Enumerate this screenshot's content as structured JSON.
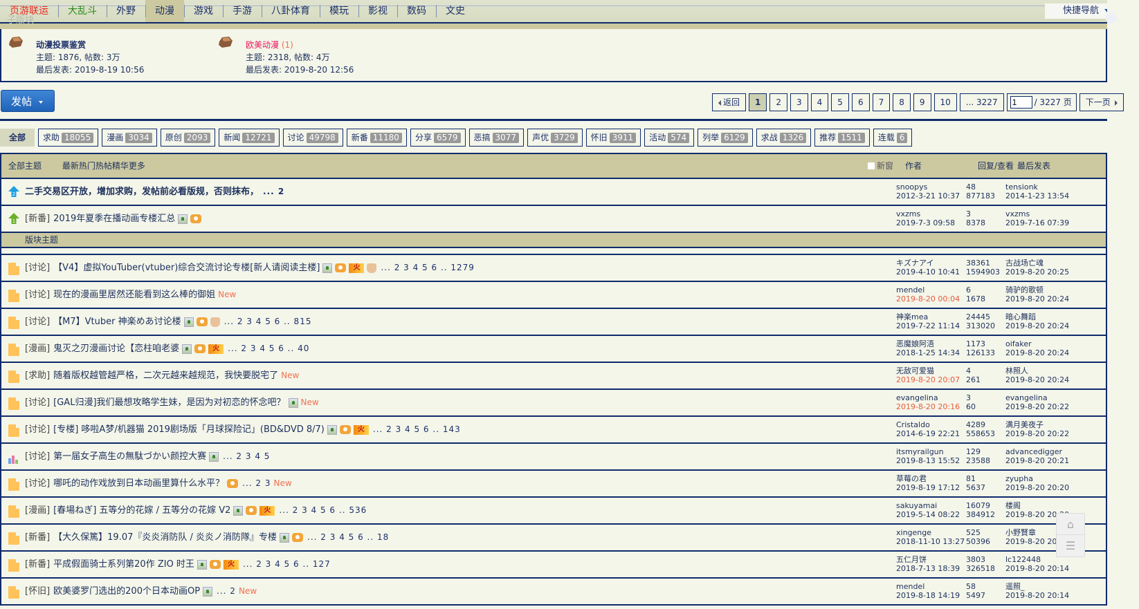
{
  "topnav": {
    "faint_label": "子版块",
    "items": [
      {
        "label": "页游联运",
        "style": "red"
      },
      {
        "label": "大乱斗",
        "style": "green"
      },
      {
        "label": "外野",
        "style": ""
      },
      {
        "label": "动漫",
        "style": "active"
      },
      {
        "label": "游戏",
        "style": ""
      },
      {
        "label": "手游",
        "style": ""
      },
      {
        "label": "八卦体育",
        "style": ""
      },
      {
        "label": "模玩",
        "style": ""
      },
      {
        "label": "影视",
        "style": ""
      },
      {
        "label": "数码",
        "style": ""
      },
      {
        "label": "文史",
        "style": ""
      }
    ],
    "quick_nav": "快捷导航"
  },
  "subforums": [
    {
      "name": "动漫投票鉴赏",
      "count": "",
      "stats": "主题: 1876, 帖数: 3万",
      "last": "最后发表: 2019-8-19 10:56"
    },
    {
      "name": "欧美动漫",
      "count": "(1)",
      "stats": "主题: 2318, 帖数: 4万",
      "last": "最后发表: 2019-8-20 12:56"
    }
  ],
  "post_button": "发帖",
  "pager": {
    "back": "返回",
    "pages": [
      "1",
      "2",
      "3",
      "4",
      "5",
      "6",
      "7",
      "8",
      "9",
      "10"
    ],
    "current": "1",
    "last": "... 3227",
    "input_value": "1",
    "total": "/ 3227 页",
    "next": "下一页"
  },
  "types": [
    {
      "label": "全部",
      "count": ""
    },
    {
      "label": "求助",
      "count": "18055"
    },
    {
      "label": "漫画",
      "count": "3034"
    },
    {
      "label": "原创",
      "count": "2093"
    },
    {
      "label": "新闻",
      "count": "12721"
    },
    {
      "label": "讨论",
      "count": "49798"
    },
    {
      "label": "新番",
      "count": "11180"
    },
    {
      "label": "分享",
      "count": "6579"
    },
    {
      "label": "恶搞",
      "count": "3077"
    },
    {
      "label": "声优",
      "count": "3729"
    },
    {
      "label": "怀旧",
      "count": "3911"
    },
    {
      "label": "活动",
      "count": "574"
    },
    {
      "label": "列举",
      "count": "6129"
    },
    {
      "label": "求战",
      "count": "1326"
    },
    {
      "label": "推荐",
      "count": "1511"
    },
    {
      "label": "连载",
      "count": "6"
    }
  ],
  "table_header": {
    "all": "全部主题",
    "filters": [
      "最新",
      "热门",
      "热帖",
      "精华",
      "更多"
    ],
    "new_window": "新窗",
    "author": "作者",
    "replies_views": "回复/查看",
    "last_post": "最后发表"
  },
  "sticky": [
    {
      "icon": "pin-2-icon",
      "tag": "",
      "title": "二手交易区开放，增加求购，发帖前必看版规，否则抹布，",
      "bold": true,
      "badges": [],
      "pages": "... 2",
      "new": "",
      "author": "snoopys",
      "date": "2012-3-21 10:37",
      "date_red": false,
      "replies": "48",
      "views": "877183",
      "last_user": "tensionk",
      "last_date": "2014-1-23 13:54"
    },
    {
      "icon": "pin-1-icon",
      "tag": "[新番]",
      "title": "2019年夏季在播动画专楼汇总",
      "bold": false,
      "badges": [
        "img",
        "cam"
      ],
      "pages": "",
      "new": "",
      "author": "vxzms",
      "date": "2019-7-3 09:58",
      "date_red": false,
      "replies": "3",
      "views": "8378",
      "last_user": "vxzms",
      "last_date": "2019-7-16 07:39"
    }
  ],
  "section_label": "版块主题",
  "threads": [
    {
      "icon": "folder",
      "tag": "[讨论]",
      "title": "【V4】虚拟YouTuber(vtuber)综合交流讨论专楼[新人请阅读主楼]",
      "badges": [
        "img",
        "cam",
        "hot",
        "like"
      ],
      "pages": "... 2 3 4 5 6 .. 1279",
      "new": "",
      "author": "キズナアイ",
      "date": "2019-4-10 10:41",
      "date_red": false,
      "replies": "38361",
      "views": "1594903",
      "last_user": "古战场亡魂",
      "last_date": "2019-8-20 20:25"
    },
    {
      "icon": "folder",
      "tag": "[讨论]",
      "title": "现在的漫画里居然还能看到这么棒的御姐",
      "badges": [],
      "pages": "",
      "new": "New",
      "author": "mendel",
      "date": "2019-8-20 00:04",
      "date_red": true,
      "replies": "6",
      "views": "1678",
      "last_user": "骑驴的歌顿",
      "last_date": "2019-8-20 20:24"
    },
    {
      "icon": "folder",
      "tag": "[讨论]",
      "title": "【M7】Vtuber 神楽めあ讨论楼",
      "badges": [
        "img",
        "cam",
        "like"
      ],
      "pages": "... 2 3 4 5 6 .. 815",
      "new": "",
      "author": "神楽mea",
      "date": "2019-7-22 11:14",
      "date_red": false,
      "replies": "24445",
      "views": "313020",
      "last_user": "暗心舞蹈",
      "last_date": "2019-8-20 20:24"
    },
    {
      "icon": "folder",
      "tag": "[漫画]",
      "title": "鬼灭之刃漫画讨论【恋柱咱老婆",
      "badges": [
        "img",
        "cam",
        "hot"
      ],
      "pages": "... 2 3 4 5 6 .. 40",
      "new": "",
      "author": "恶魔娘阿浯",
      "date": "2018-1-25 14:34",
      "date_red": false,
      "replies": "1173",
      "views": "126133",
      "last_user": "oifaker",
      "last_date": "2019-8-20 20:24"
    },
    {
      "icon": "folder",
      "tag": "[求助]",
      "title": "随着版权越管越严格，二次元越来越规范，我快要脱宅了",
      "badges": [],
      "pages": "",
      "new": "New",
      "author": "无敌可爱猫",
      "date": "2019-8-20 20:07",
      "date_red": true,
      "replies": "4",
      "views": "261",
      "last_user": "林照人",
      "last_date": "2019-8-20 20:24"
    },
    {
      "icon": "folder",
      "tag": "[讨论]",
      "title": "[GAL归漫]我们最想攻略学生妹，是因为对初恋的怀念吧？",
      "badges": [
        "img"
      ],
      "pages": "",
      "new": "New",
      "author": "evangelina",
      "date": "2019-8-20 20:16",
      "date_red": true,
      "replies": "3",
      "views": "60",
      "last_user": "evangelina",
      "last_date": "2019-8-20 20:22"
    },
    {
      "icon": "folder",
      "tag": "[讨论]",
      "title": "[专楼] 哆啦A梦/机器猫 2019剧场版「月球探险记」(BD&DVD 8/7)",
      "badges": [
        "img",
        "cam",
        "hot"
      ],
      "pages": "... 2 3 4 5 6 .. 143",
      "new": "",
      "author": "Cristaldo",
      "date": "2014-6-19 22:21",
      "date_red": false,
      "replies": "4289",
      "views": "558653",
      "last_user": "满月美夜子",
      "last_date": "2019-8-20 20:22"
    },
    {
      "icon": "poll",
      "tag": "[讨论]",
      "title": "第一届女子高生の無駄づかい颜控大赛",
      "badges": [
        "img"
      ],
      "pages": "... 2 3 4 5",
      "new": "",
      "author": "itsmyrailgun",
      "date": "2019-8-13 15:52",
      "date_red": false,
      "replies": "129",
      "views": "23588",
      "last_user": "advancedigger",
      "last_date": "2019-8-20 20:21"
    },
    {
      "icon": "folder",
      "tag": "[讨论]",
      "title": "哪吒的动作戏放到日本动画里算什么水平？",
      "badges": [
        "cam"
      ],
      "pages": "... 2 3",
      "new": "New",
      "author": "草莓の君",
      "date": "2019-8-19 17:12",
      "date_red": false,
      "replies": "81",
      "views": "5637",
      "last_user": "zyupha",
      "last_date": "2019-8-20 20:20"
    },
    {
      "icon": "folder",
      "tag": "[漫画]",
      "title": "[春場ねぎ] 五等分的花嫁 / 五等分の花嫁 V2",
      "badges": [
        "img",
        "cam",
        "hot"
      ],
      "pages": "... 2 3 4 5 6 .. 536",
      "new": "",
      "author": "sakuyamai",
      "date": "2019-5-14 08:22",
      "date_red": false,
      "replies": "16079",
      "views": "384912",
      "last_user": "楼阁",
      "last_date": "2019-8-20 20:20"
    },
    {
      "icon": "folder",
      "tag": "[新番]",
      "title": "【大久保篤】19.07『炎炎消防队 / 炎炎ノ消防隊』专楼",
      "badges": [
        "img",
        "cam"
      ],
      "pages": "... 2 3 4 5 6 .. 18",
      "new": "",
      "author": "xingenge",
      "date": "2018-11-10 13:27",
      "date_red": false,
      "replies": "525",
      "views": "50396",
      "last_user": "小野賢章",
      "last_date": "2019-8-20 20:19"
    },
    {
      "icon": "folder",
      "tag": "[新番]",
      "title": "平成假面骑士系列第20作 ZIO 时王",
      "badges": [
        "img",
        "cam",
        "hot"
      ],
      "pages": "... 2 3 4 5 6 .. 127",
      "new": "",
      "author": "五仁月饼",
      "date": "2018-7-13 18:39",
      "date_red": false,
      "replies": "3803",
      "views": "326518",
      "last_user": "lc122448",
      "last_date": "2019-8-20 20:14"
    },
    {
      "icon": "folder",
      "tag": "[怀旧]",
      "title": "欧美婆罗门选出的200个日本动画OP",
      "badges": [
        "img"
      ],
      "pages": "... 2",
      "new": "New",
      "author": "mendel",
      "date": "2019-8-18 14:19",
      "date_red": false,
      "replies": "58",
      "views": "5497",
      "last_user": "遥照_",
      "last_date": "2019-8-20 20:14"
    }
  ],
  "float_tools": [
    "back-to-top",
    "thread-list"
  ]
}
